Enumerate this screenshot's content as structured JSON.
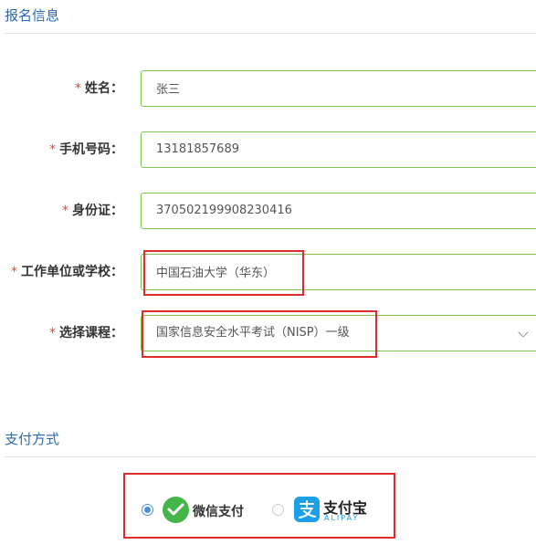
{
  "registration": {
    "section_title": "报名信息",
    "required_mark": "*",
    "name": {
      "label": "姓名：",
      "value": "张三"
    },
    "phone": {
      "label": "手机号码：",
      "value": "13181857689"
    },
    "id_card": {
      "label": "身份证：",
      "value": "370502199908230416"
    },
    "workplace": {
      "label": "工作单位或学校：",
      "value": "中国石油大学（华东）"
    },
    "course": {
      "label": "选择课程：",
      "value": "国家信息安全水平考试（NISP）一级"
    }
  },
  "payment": {
    "section_title": "支付方式",
    "wechat": {
      "label": "微信支付",
      "checked": true
    },
    "alipay": {
      "label": "支付宝",
      "sub_label": "ALIPAY",
      "checked": false
    }
  },
  "colors": {
    "accent_blue": "#2b6cb0",
    "field_border_green": "#7cc34f",
    "required_red": "#e04a3a",
    "highlight_red": "#e02b2b",
    "wechat_green": "#44b549",
    "alipay_blue": "#1da0e8"
  },
  "icons": {
    "select_arrow": "chevron-down-icon",
    "wechat_logo": "wechat-pay-icon",
    "alipay_logo": "alipay-icon"
  }
}
